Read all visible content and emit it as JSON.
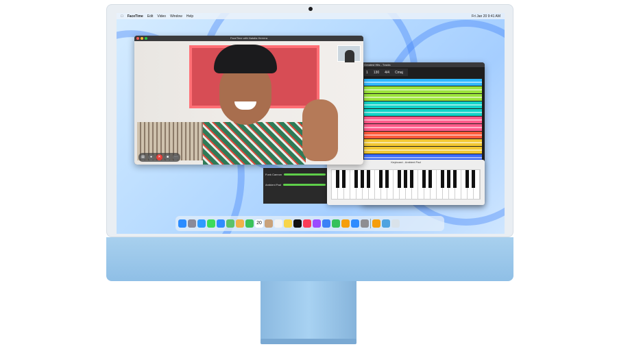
{
  "menubar": {
    "apple_icon": "apple-icon",
    "app_name": "FaceTime",
    "items": [
      "Edit",
      "Video",
      "Window",
      "Help"
    ],
    "clock": "Fri Jan 20 9:41 AM"
  },
  "facetime": {
    "window_title": "FaceTime with Natalia Herrera",
    "controls": [
      "sidebar",
      "mute",
      "end-call",
      "video",
      "more"
    ]
  },
  "garageband": {
    "window_title": "Greatest Hits - Tracks",
    "bar": "1",
    "tempo": "130",
    "time_sig": "4/4",
    "key": "Cmaj"
  },
  "mixer": {
    "tracks": [
      "Funk Cannon",
      "Ambient Pad"
    ]
  },
  "keyboard": {
    "title": "Keyboard - Ambient Pad"
  },
  "track_colors": [
    "#2fb8ff",
    "#9be43a",
    "#9be43a",
    "#13d3c8",
    "#13d3c8",
    "#ff5a8a",
    "#ff5a8a",
    "#ff5a3a",
    "#f2c832",
    "#f2c832",
    "#3b6dff",
    "#3b6dff",
    "#8f5dff",
    "#8f5dff",
    "#2fb8ff",
    "#2fb8ff"
  ],
  "dock": [
    "finder-icon",
    "launchpad-icon",
    "safari-icon",
    "messages-icon",
    "mail-icon",
    "maps-icon",
    "photos-icon",
    "facetime-icon",
    "calendar-icon",
    "contacts-icon",
    "reminders-icon",
    "notes-icon",
    "tv-icon",
    "music-icon",
    "podcasts-icon",
    "keynote-icon",
    "numbers-icon",
    "pages-icon",
    "app-store-icon",
    "settings-icon",
    "garageband-icon",
    "downloads-icon",
    "trash-icon"
  ],
  "dock_calendar_day": "20"
}
